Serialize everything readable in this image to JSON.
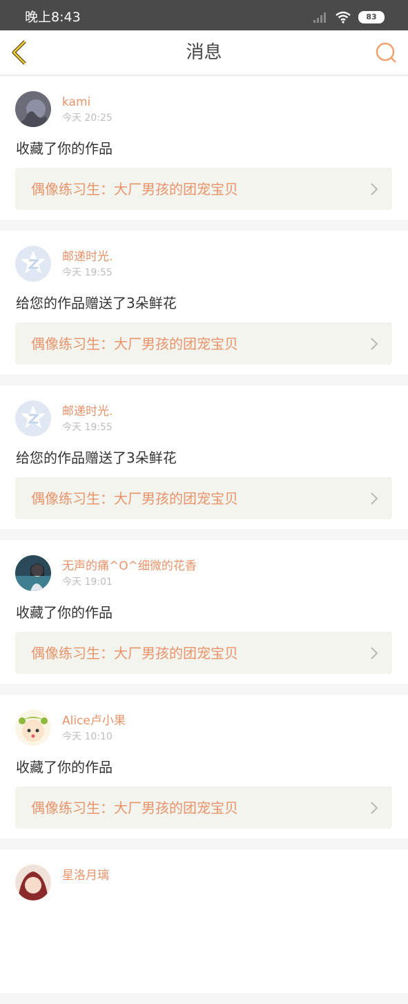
{
  "status_bar": {
    "time": "晚上8:43",
    "battery": "83"
  },
  "nav": {
    "title": "消息",
    "back_icon": "chevron-left-icon",
    "search_icon": "search-icon"
  },
  "messages": [
    {
      "user": "kami",
      "time": "今天 20:25",
      "action": "收藏了你的作品",
      "work": "偶像练习生：大厂男孩的团宠宝贝"
    },
    {
      "user": "邮递时光.",
      "time": "今天 19:55",
      "action": "给您的作品赠送了3朵鲜花",
      "work": "偶像练习生：大厂男孩的团宠宝贝"
    },
    {
      "user": "邮递时光.",
      "time": "今天 19:55",
      "action": "给您的作品赠送了3朵鲜花",
      "work": "偶像练习生：大厂男孩的团宠宝贝"
    },
    {
      "user": "无声的痛^O^细微的花香",
      "time": "今天 19:01",
      "action": "收藏了你的作品",
      "work": "偶像练习生：大厂男孩的团宠宝贝"
    },
    {
      "user": "Alice卢小果",
      "time": "今天 10:10",
      "action": "收藏了你的作品",
      "work": "偶像练习生：大厂男孩的团宠宝贝"
    },
    {
      "user": "星洛月璃",
      "time": "",
      "action": "",
      "work": ""
    }
  ],
  "colors": {
    "accent": "#e8936a",
    "status_bar": "#4a4a4a",
    "card_link_bg": "#f4f4ef"
  }
}
